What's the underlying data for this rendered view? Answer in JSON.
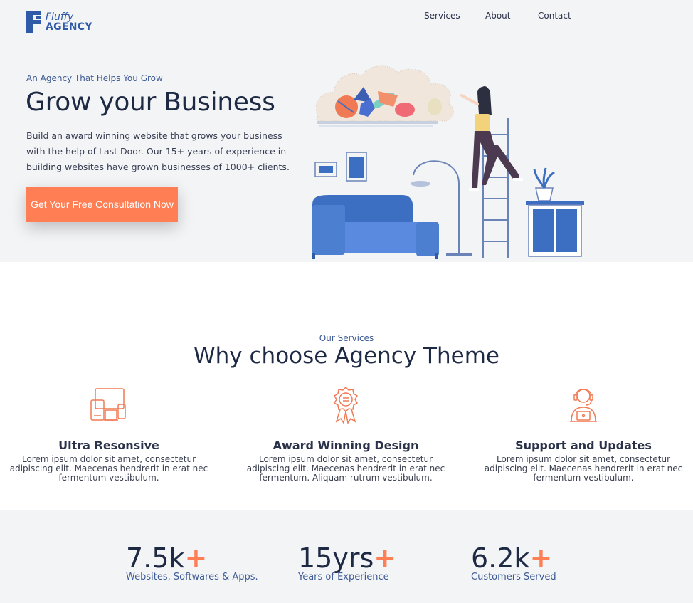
{
  "brand": {
    "name_line1": "Fluffy",
    "name_line2": "AGENCY",
    "color": "#2f5aa8"
  },
  "nav": {
    "items": [
      "Services",
      "About",
      "Contact"
    ]
  },
  "hero": {
    "eyebrow": "An Agency That Helps You Grow",
    "title": "Grow your Business",
    "description": "Build an award winning website that grows your business with the help of Last Door. Our 15+ years of experience in building websites have grown businesses of 1000+ clients.",
    "cta_label": "Get Your Free Consultation Now",
    "accent": "#ff7e54"
  },
  "services": {
    "eyebrow": "Our Services",
    "title": "Why choose Agency Theme",
    "cards": [
      {
        "icon": "devices-icon",
        "title": "Ultra Resonsive",
        "text": "Lorem ipsum dolor sit amet, consectetur adipiscing elit. Maecenas hendrerit in erat nec fermentum vestibulum."
      },
      {
        "icon": "award-ribbon-icon",
        "title": "Award Winning Design",
        "text": "Lorem ipsum dolor sit amet, consectetur adipiscing elit. Maecenas hendrerit in erat nec fermentum. Aliquam rutrum vestibulum."
      },
      {
        "icon": "support-agent-icon",
        "title": "Support and Updates",
        "text": "Lorem ipsum dolor sit amet, consectetur adipiscing elit. Maecenas hendrerit in erat nec fermentum vestibulum."
      }
    ]
  },
  "stats": [
    {
      "value": "7.5k",
      "suffix": "+",
      "label": "Websites, Softwares & Apps."
    },
    {
      "value": "15yrs",
      "suffix": "+",
      "label": "Years of Experience"
    },
    {
      "value": "6.2k",
      "suffix": "+",
      "label": "Customers Served"
    }
  ]
}
